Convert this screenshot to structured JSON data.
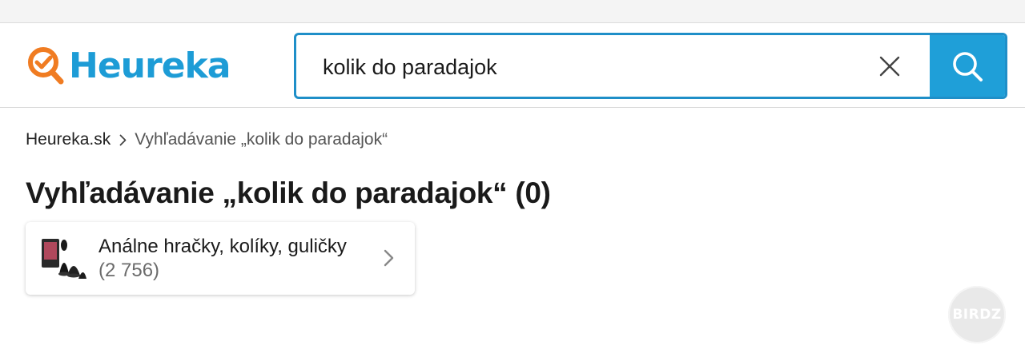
{
  "brand": {
    "name": "Heureka",
    "logo_color": "#1d9cd6",
    "mark_color": "#f07c22"
  },
  "search": {
    "value": "kolik do paradajok",
    "accent_color": "#1f9fd8",
    "clear_icon": "close-icon",
    "submit_icon": "search-icon"
  },
  "breadcrumb": {
    "home": "Heureka.sk",
    "separator_icon": "chevron-right-icon",
    "current": "Vyhľadávanie „kolik do paradajok“"
  },
  "page": {
    "title": "Vyhľadávanie „kolik do paradajok“ (0)"
  },
  "categories": [
    {
      "label": "Análne hračky, kolíky, guličky",
      "count": "(2 756)",
      "icon": "chevron-right-icon"
    }
  ],
  "watermark": {
    "text": "BIRDZ"
  }
}
